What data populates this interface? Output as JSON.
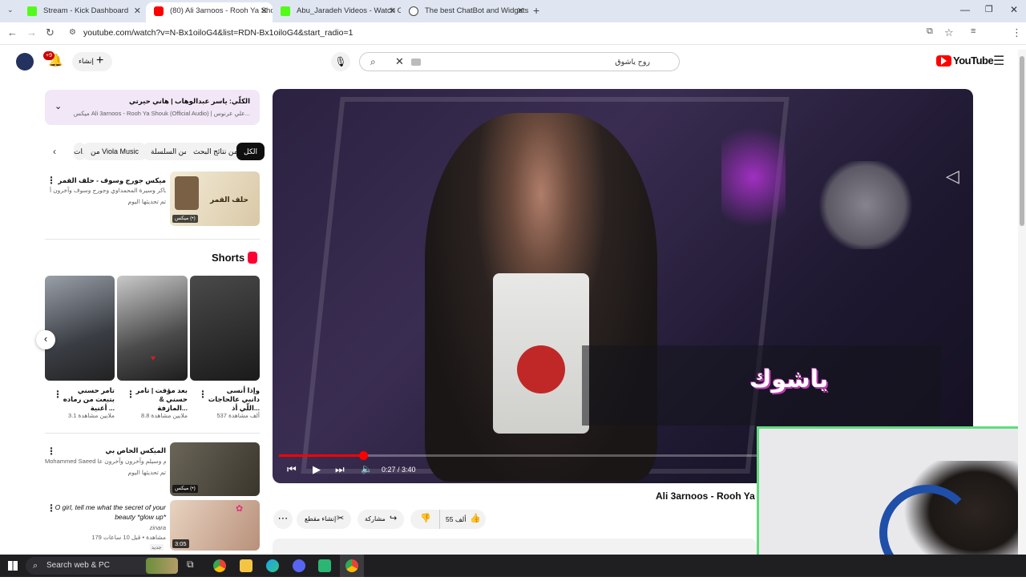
{
  "browser": {
    "tabs": [
      {
        "title": "Stream - Kick Dashboard",
        "color": "#53fc18"
      },
      {
        "title": "(80) Ali 3arnoos - Rooh Ya Shou",
        "color": "#ff0000"
      },
      {
        "title": "Abu_Jaradeh Videos - Watch On",
        "color": "#53fc18"
      },
      {
        "title": "The best ChatBot and Widgets f",
        "color": "#444444"
      }
    ],
    "url": "youtube.com/watch?v=N-Bx1oiloG4&list=RDN-Bx1oiloG4&start_radio=1"
  },
  "youtube": {
    "logo_text": "YouTube",
    "notif_badge": "+9",
    "create_label": "إنشاء",
    "search_value": "روح ياشوق"
  },
  "playlist": {
    "title": "الكلّي: ياسر عبدالوهاب | هاني حيرتي",
    "subtitle": "ميكس Ali 3arnoos - Rooh Ya Shouk (Official Audio) | علي عرنوس..."
  },
  "chips": [
    "الكل",
    "من نتائج البحث",
    "من السلسلة",
    "من Viola Music",
    "ذات"
  ],
  "recs": [
    {
      "title": "ميكس جورج وسوف - حلف القمر",
      "sub": "فضل شاكر وسيرة المحمداوي وجورج وسوف وآخرون أ...",
      "meta": "تم تحديثها اليوم",
      "badge": "ميكس (•)",
      "thumb_text": "حلف القمر"
    }
  ],
  "shorts": {
    "heading": "Shorts",
    "items": [
      {
        "title": "وإذا أنسى دانبي عالحاجات اللّي أذ...",
        "views": "537 ألف مشاهدة"
      },
      {
        "title": "بعد مؤقت | تامر حسني & المازفة...",
        "views": "8.8 ملايين مشاهدة"
      },
      {
        "title": "تامر حسني بتبعت من رماده أغنية ...",
        "views": "3.1 ملايين مشاهدة"
      }
    ]
  },
  "recs2": [
    {
      "title": "الميكس الخاص بي",
      "sub": "Mohammed Saeed وكاظم وسيلم وآخرون وآخرون عا...",
      "meta": "تم تحديثها اليوم",
      "badge": "ميكس (•)"
    },
    {
      "title": "O girl, tell me what the secret of your beauty *glow up*",
      "sub": "zinara",
      "meta": "179 مشاهدة • قبل 10 ساعات",
      "badge": "3:05",
      "extra": "جديد"
    }
  ],
  "player": {
    "time": "0:27 / 3:40",
    "progress": 0.123,
    "overlay_text": "ياشوك"
  },
  "video_title": "Ali 3arnoos - Rooh Ya",
  "actions": {
    "likes": "55 ألف",
    "share": "مشاركة",
    "clip": "إنشاء مقطع"
  },
  "taskbar": {
    "search_label": "Search web & PC"
  }
}
